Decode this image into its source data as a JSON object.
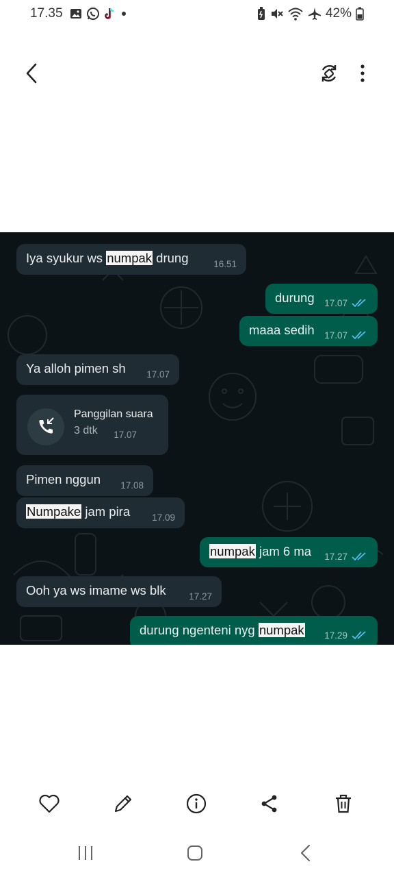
{
  "status_bar": {
    "time": "17.35",
    "battery": "42%",
    "left_icons": [
      "gallery-icon",
      "whatsapp-icon",
      "tiktok-icon",
      "dot-icon"
    ],
    "right_icons": [
      "battery-saver-icon",
      "mute-icon",
      "wifi-icon",
      "airplane-icon",
      "battery-icon"
    ]
  },
  "top_bar": {
    "back_icon": "back-arrow-icon",
    "rotate_icon": "rotate-icon",
    "more_icon": "more-vert-icon"
  },
  "chat": {
    "messages": [
      {
        "dir": "in",
        "parts": [
          [
            "Iya syukur ws ",
            false
          ],
          [
            "numpak",
            true
          ],
          [
            " drung",
            false
          ]
        ],
        "time": "16.51"
      },
      {
        "dir": "out",
        "parts": [
          [
            "durung",
            false
          ]
        ],
        "time": "17.07",
        "read": true
      },
      {
        "dir": "out",
        "parts": [
          [
            "maaa sedih",
            false
          ]
        ],
        "time": "17.07",
        "read": true
      },
      {
        "dir": "in",
        "parts": [
          [
            "Ya alloh pimen sh",
            false
          ]
        ],
        "time": "17.07"
      },
      {
        "dir": "in",
        "type": "call",
        "title": "Panggilan suara",
        "subtitle": "3 dtk",
        "time": "17.07"
      },
      {
        "dir": "in",
        "parts": [
          [
            "Pimen nggun",
            false
          ]
        ],
        "time": "17.08"
      },
      {
        "dir": "in",
        "parts": [
          [
            "Numpake",
            true
          ],
          [
            " jam pira",
            false
          ]
        ],
        "time": "17.09"
      },
      {
        "dir": "out",
        "parts": [
          [
            "numpak",
            true
          ],
          [
            " jam 6 ma",
            false
          ]
        ],
        "time": "17.27",
        "read": true
      },
      {
        "dir": "in",
        "parts": [
          [
            "Ooh ya ws imame ws blk",
            false
          ]
        ],
        "time": "17.27"
      },
      {
        "dir": "out",
        "parts": [
          [
            "durung ngenteni nyg ",
            false
          ],
          [
            "numpak",
            true
          ]
        ],
        "time": "17.29",
        "read": true
      }
    ]
  },
  "bottom_actions": [
    "heart-icon",
    "edit-icon",
    "info-icon",
    "share-icon",
    "delete-icon"
  ],
  "nav_bar": [
    "recents-icon",
    "home-icon",
    "back-icon"
  ],
  "colors": {
    "chat_bg": "#0c1316",
    "incoming_bubble": "#1f2c33",
    "outgoing_bubble": "#005c4b",
    "read_ticks": "#53bdeb",
    "highlight": "#f4f4f4"
  }
}
